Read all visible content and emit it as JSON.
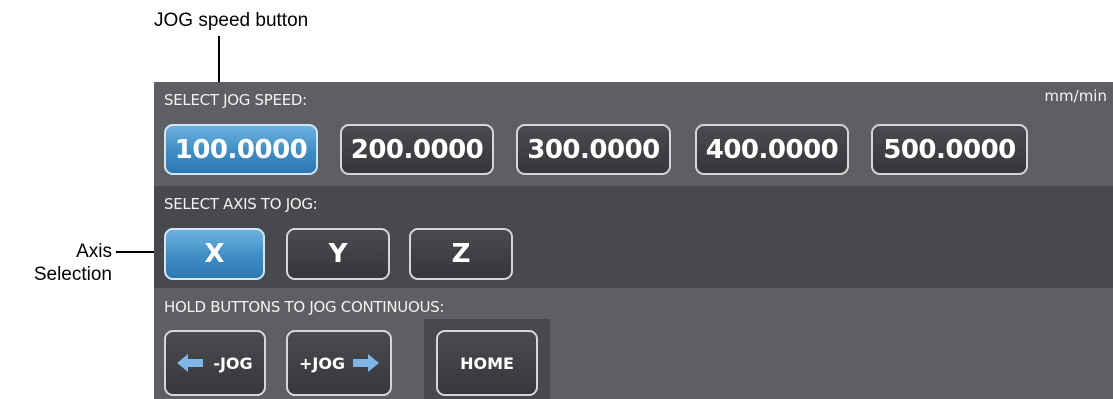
{
  "callouts": {
    "top": "JOG speed button",
    "left_line1": "Axis",
    "left_line2": "Selection"
  },
  "jog_speed": {
    "label": "SELECT JOG SPEED:",
    "units": "mm/min",
    "options": [
      "100.0000",
      "200.0000",
      "300.0000",
      "400.0000",
      "500.0000"
    ],
    "selected": "100.0000"
  },
  "axis": {
    "label": "SELECT AXIS TO JOG:",
    "options": [
      "X",
      "Y",
      "Z"
    ],
    "selected": "X"
  },
  "continuous": {
    "label": "HOLD BUTTONS TO JOG CONTINUOUS:",
    "minus_label": "-JOG",
    "plus_label": "+JOG",
    "home_label": "HOME"
  },
  "colors": {
    "panel_light": "#5e5f63",
    "panel_dark": "#48494d",
    "active_blue": "#3f8cc4",
    "arrow_blue": "#7fb6e6"
  },
  "icons": [
    "arrow-left-icon",
    "arrow-right-icon"
  ]
}
